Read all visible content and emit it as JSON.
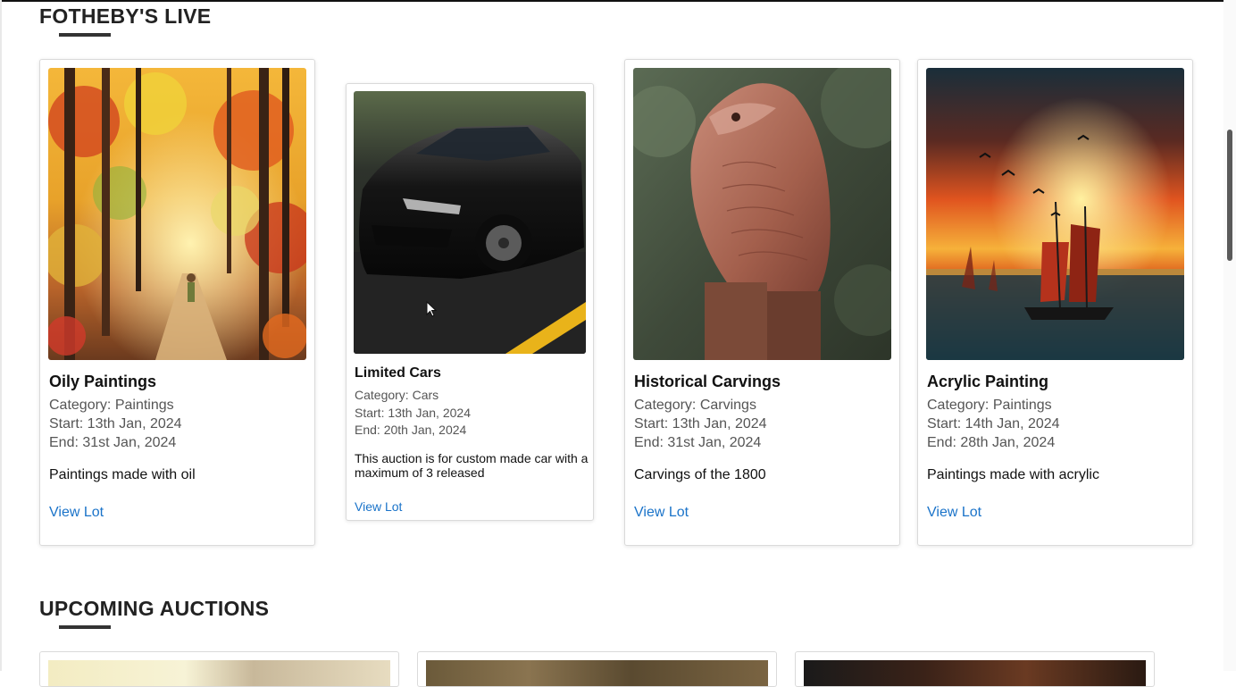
{
  "live_section": {
    "title": "FOTHEBY'S LIVE",
    "cards": [
      {
        "title": "Oily Paintings",
        "category": "Category: Paintings",
        "start": "Start: 13th Jan, 2024",
        "end": "End: 31st Jan, 2024",
        "description": "Paintings made with oil",
        "link": "View Lot"
      },
      {
        "title": "Limited Cars",
        "category": "Category: Cars",
        "start": "Start: 13th Jan, 2024",
        "end": "End: 20th Jan, 2024",
        "description": "This auction is for custom made car with a maximum of 3 released",
        "link": "View Lot"
      },
      {
        "title": "Historical Carvings",
        "category": "Category: Carvings",
        "start": "Start: 13th Jan, 2024",
        "end": "End: 31st Jan, 2024",
        "description": "Carvings of the 1800",
        "link": "View Lot"
      },
      {
        "title": "Acrylic Painting",
        "category": "Category: Paintings",
        "start": "Start: 14th Jan, 2024",
        "end": "End: 28th Jan, 2024",
        "description": "Paintings made with acrylic",
        "link": "View Lot"
      }
    ]
  },
  "upcoming_section": {
    "title": "UPCOMING AUCTIONS"
  },
  "colors": {
    "link": "#1a73c9",
    "heading": "#222222",
    "meta_text": "#555555"
  }
}
